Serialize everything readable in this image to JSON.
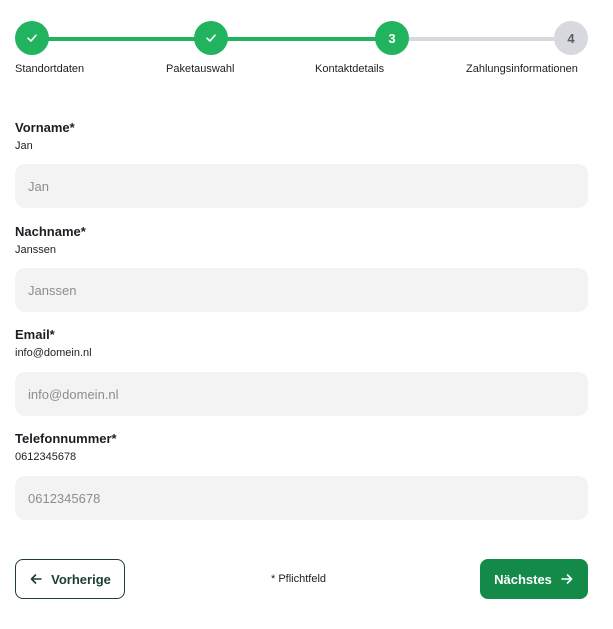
{
  "stepper": {
    "steps": [
      {
        "label": "Standortdaten",
        "status": "done",
        "icon": "check-icon"
      },
      {
        "label": "Paketauswahl",
        "status": "done",
        "icon": "check-icon"
      },
      {
        "label": "Kontaktdetails",
        "status": "active",
        "number": "3"
      },
      {
        "label": "Zahlungsinformationen",
        "status": "todo",
        "number": "4"
      }
    ],
    "colors": {
      "done": "#22b35e",
      "todo": "#d7d9de"
    }
  },
  "form": {
    "fields": [
      {
        "label": "Vorname*",
        "value": "Jan",
        "placeholder": "Jan"
      },
      {
        "label": "Nachname*",
        "value": "Janssen",
        "placeholder": "Janssen"
      },
      {
        "label": "Email*",
        "value": "info@domein.nl",
        "placeholder": "info@domein.nl"
      },
      {
        "label": "Telefonnummer*",
        "value": "0612345678",
        "placeholder": "0612345678"
      }
    ]
  },
  "footer": {
    "prev_label": "Vorherige",
    "next_label": "Nächstes",
    "required_note": "* Pflichtfeld",
    "colors": {
      "next_bg": "#138a47",
      "prev_border": "#1c3d36"
    }
  }
}
